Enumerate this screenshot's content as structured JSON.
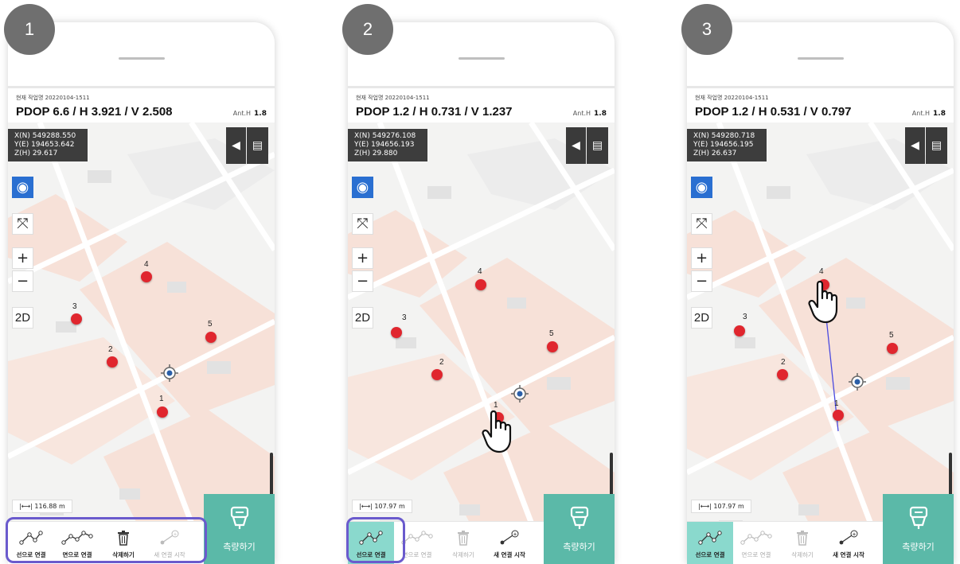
{
  "steps": [
    "1",
    "2",
    "3"
  ],
  "panels": [
    {
      "job_label": "현재 작업명 20220104-1511",
      "pdop": "PDOP 6.6 / H 3.921 / V 2.508",
      "ant_label": "Ant.H",
      "ant_value": "1.8",
      "coords": [
        "X(N) 549288.550",
        "Y(E) 194653.642",
        "Z(H) 29.617"
      ],
      "scale": "116.88 m",
      "buttons": [
        "선으로 연결",
        "면으로 연결",
        "삭제하기",
        "새 연결 시작"
      ],
      "measure": "측량하기"
    },
    {
      "job_label": "현재 작업명 20220104-1511",
      "pdop": "PDOP 1.2 / H 0.731 / V 1.237",
      "ant_label": "Ant.H",
      "ant_value": "1.8",
      "coords": [
        "X(N) 549276.108",
        "Y(E) 194656.193",
        "Z(H) 29.880"
      ],
      "scale": "107.97 m",
      "buttons": [
        "선으로 연결",
        "면으로 연결",
        "삭제하기",
        "새 연결 시작"
      ],
      "measure": "측량하기"
    },
    {
      "job_label": "현재 작업명 20220104-1511",
      "pdop": "PDOP 1.2 / H 0.531 / V 0.797",
      "ant_label": "Ant.H",
      "ant_value": "1.8",
      "coords": [
        "X(N) 549280.718",
        "Y(E) 194656.195",
        "Z(H) 26.637"
      ],
      "scale": "107.97 m",
      "buttons": [
        "선으로 연결",
        "면으로 연결",
        "삭제하기",
        "새 연결 시작"
      ],
      "measure": "측량하기"
    }
  ],
  "tools": {
    "zoom_in": "+",
    "zoom_out": "−",
    "mode_2d": "2D"
  },
  "point_labels": [
    "1",
    "2",
    "3",
    "4",
    "5"
  ],
  "colors": {
    "accent_teal": "#5bb9a8",
    "active_teal": "#8ad9cd",
    "point_red": "#e0262e",
    "locate_blue": "#2a6fd1",
    "highlight_purple": "#6a5acd"
  }
}
